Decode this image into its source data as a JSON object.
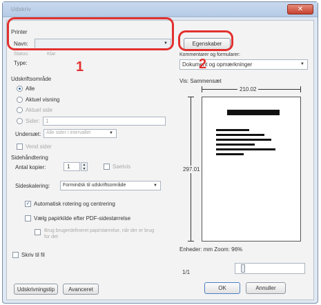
{
  "window": {
    "title": "Udskriv",
    "close": "✕"
  },
  "printer": {
    "group_label": "Printer",
    "name_label": "Navn:",
    "name_value": "",
    "status_label": "Status:",
    "status_value": "Klar",
    "type_label": "Type:",
    "type_value": "",
    "properties_button": "Egenskaber",
    "comments_label": "Kommentarer og formularer:",
    "comments_value": "Dokument og opmærkninger"
  },
  "range": {
    "group_label": "Udskriftsområde",
    "all": "Alle",
    "current_view": "Aktuel visning",
    "current_page": "Aktuel side",
    "pages": "Sider:",
    "pages_value": "1",
    "subset_label": "Undersæt:",
    "subset_value": "Alle sider i intervallet",
    "reverse": "Vend sider"
  },
  "handling": {
    "group_label": "Sidehåndtering",
    "copies_label": "Antal kopier:",
    "copies_value": "1",
    "collate": "Saetvis",
    "scaling_label": "Sideskalering:",
    "scaling_value": "Formindsk til udskriftsområde",
    "auto_rotate": "Automatisk rotering og centrering",
    "choose_paper": "Vælg papirkilde efter PDF-sidestørrelse",
    "custom_paper": "Brug brugerdefineret papirstørrelse, når der er brug for det",
    "print_to_file": "Skriv til fil"
  },
  "preview": {
    "zoom_label": "Vis: Sammensæt",
    "width": "210.02",
    "height": "297.01",
    "units": "Enheder: mm Zoom: 96%",
    "page_counter": "1/1"
  },
  "footer": {
    "tips": "Udskrivningstip",
    "advanced": "Avanceret",
    "ok": "OK",
    "cancel": "Annuller"
  },
  "annotations": {
    "one": "1",
    "two": "2",
    "color": "#e2302f"
  }
}
